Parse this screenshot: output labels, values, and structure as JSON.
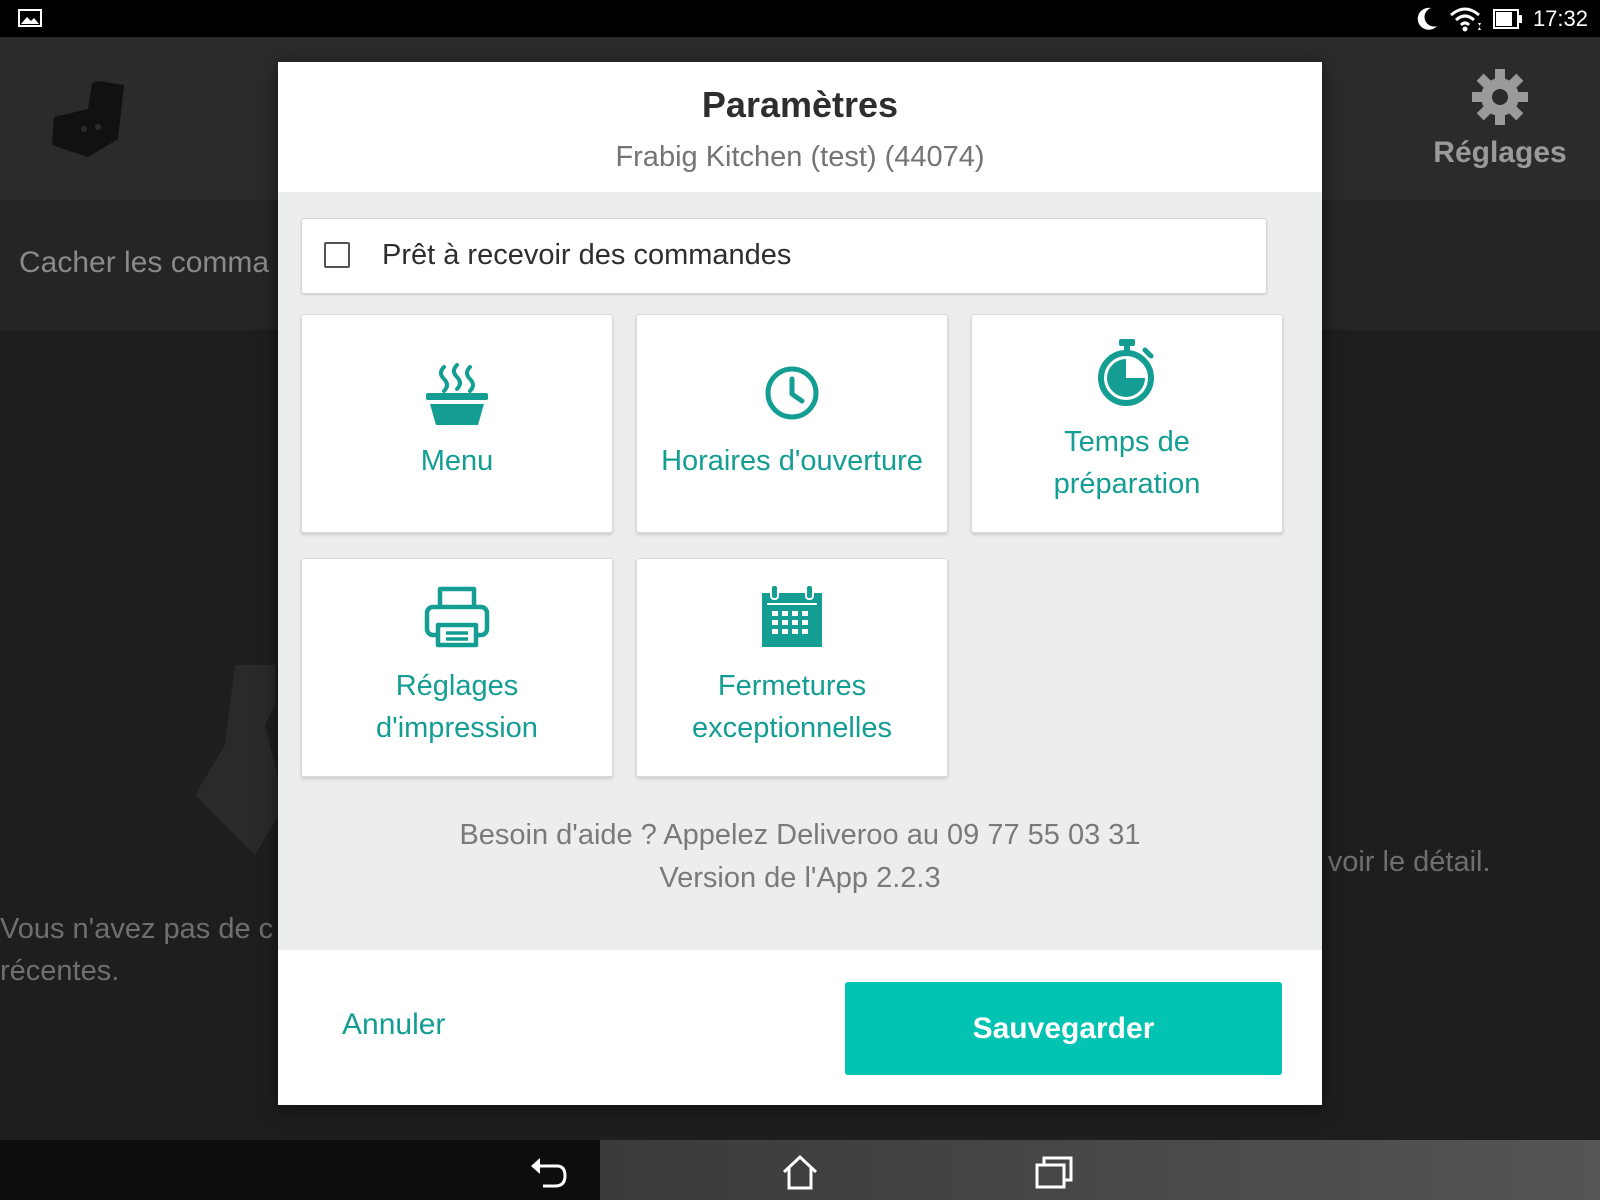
{
  "status_bar": {
    "time": "17:32",
    "icons": [
      "image-icon",
      "moon-icon",
      "wifi-icon",
      "battery-icon"
    ]
  },
  "background_app": {
    "settings_label": "Réglages",
    "hide_orders_text": "Cacher les comma",
    "empty_text_line1": "Vous n'avez pas de c",
    "empty_text_line2": "récentes.",
    "detail_text": "r voir le détail."
  },
  "dialog": {
    "title": "Paramètres",
    "subtitle": "Frabig Kitchen (test) (44074)",
    "ready_checkbox": {
      "label": "Prêt à recevoir des commandes",
      "checked": false
    },
    "tiles": [
      {
        "label_line1": "Menu",
        "label_line2": "",
        "icon": "food-bowl-icon"
      },
      {
        "label_line1": "Horaires d'ouverture",
        "label_line2": "",
        "icon": "clock-icon"
      },
      {
        "label_line1": "Temps de",
        "label_line2": "préparation",
        "icon": "stopwatch-icon"
      },
      {
        "label_line1": "Réglages",
        "label_line2": "d'impression",
        "icon": "printer-icon"
      },
      {
        "label_line1": "Fermetures",
        "label_line2": "exceptionnelles",
        "icon": "calendar-icon"
      }
    ],
    "help_text": "Besoin d'aide ? Appelez Deliveroo au 09 77 55 03 31",
    "version_text": "Version de l'App 2.2.3",
    "cancel_label": "Annuler",
    "save_label": "Sauvegarder"
  },
  "colors": {
    "accent": "#00c3b2",
    "accent_text": "#149e93",
    "dialog_bg": "#eceeee"
  }
}
